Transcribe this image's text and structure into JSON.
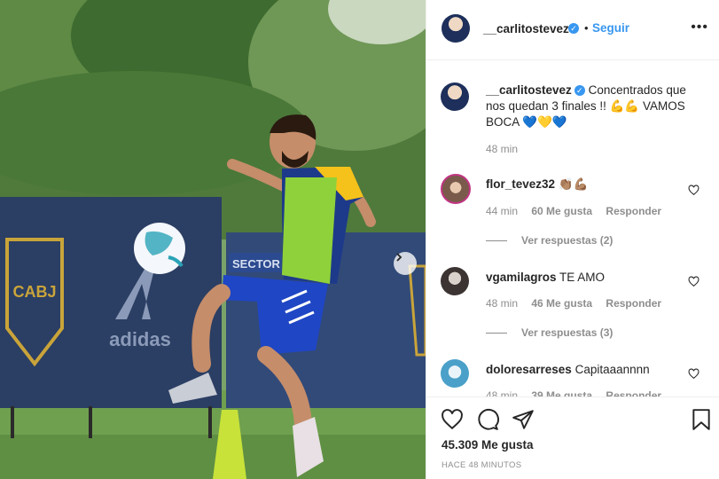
{
  "post": {
    "author": "__carlitostevez",
    "follow_label": "Seguir",
    "separator": "•",
    "more_label": "•••",
    "caption_user": "__carlitostevez",
    "caption_text": "Concentrados que nos quedan 3 finales !! 💪💪 VAMOS BOCA 💙💛💙",
    "caption_time": "48 min",
    "likes": "45.309 Me gusta",
    "posted_ago": "HACE 48 MINUTOS"
  },
  "comments": [
    {
      "user": "flor_tevez32",
      "text": "👏🏽💪🏽",
      "time": "44 min",
      "likes": "60 Me gusta",
      "reply_label": "Responder",
      "view_replies": "Ver respuestas (2)"
    },
    {
      "user": "vgamilagros",
      "text": "TE AMO",
      "time": "48 min",
      "likes": "46 Me gusta",
      "reply_label": "Responder",
      "view_replies": "Ver respuestas (3)"
    },
    {
      "user": "doloresarreses",
      "text": "Capitaaannnn",
      "time": "48 min",
      "likes": "39 Me gusta",
      "reply_label": "Responder"
    }
  ],
  "photo": {
    "banner_left_logo": "CABJ",
    "banner_brand": "adidas",
    "banner_sector": "SECTOR"
  },
  "colors": {
    "link_blue": "#3897f0",
    "boca_blue": "#1d3a8a",
    "boca_gold": "#f4c21a"
  }
}
